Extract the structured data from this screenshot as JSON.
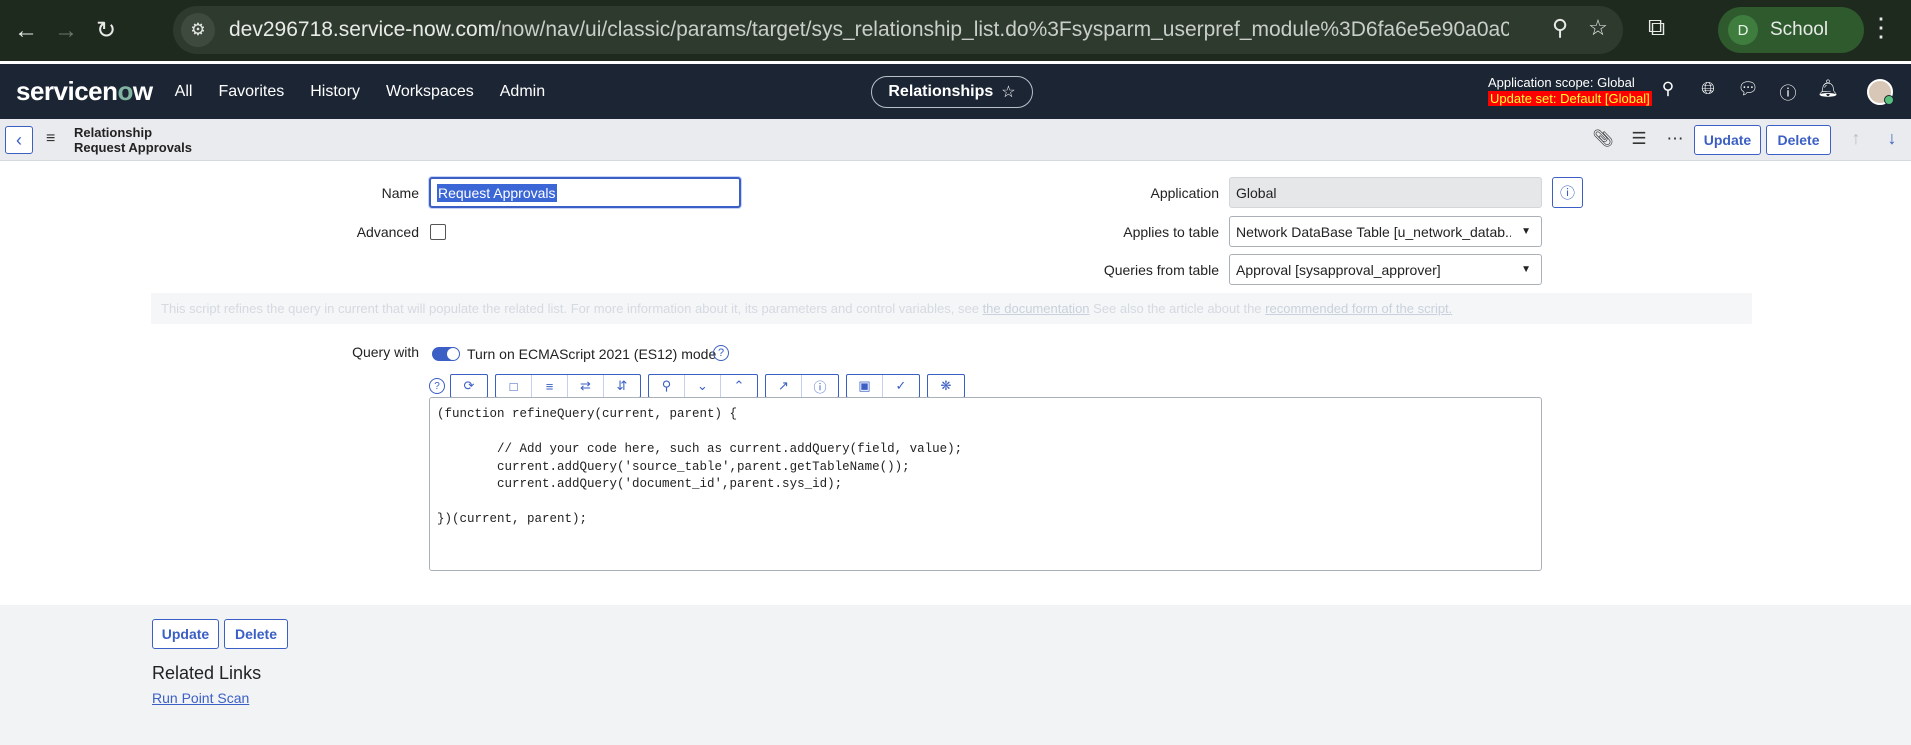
{
  "browser": {
    "url_main": "dev296718.service-now.com",
    "url_path": "/now/nav/ui/classic/params/target/sys_relationship_list.do%3Fsysparm_userpref_module%3D6fa6e5e90a0a0...",
    "profile_initial": "D",
    "profile_name": "School"
  },
  "header": {
    "logo": "servicenow",
    "nav": [
      "All",
      "Favorites",
      "History",
      "Workspaces",
      "Admin"
    ],
    "context_pill": "Relationships",
    "app_scope": "Application scope: Global",
    "update_set": "Update set: Default [Global]"
  },
  "form_header": {
    "table": "Relationship",
    "record": "Request Approvals",
    "update_label": "Update",
    "delete_label": "Delete"
  },
  "fields": {
    "name_label": "Name",
    "name_value": "Request Approvals",
    "advanced_label": "Advanced",
    "application_label": "Application",
    "application_value": "Global",
    "applies_label": "Applies to table",
    "applies_value": "Network DataBase Table [u_network_datab...",
    "queries_label": "Queries from table",
    "queries_value": "Approval [sysapproval_approver]"
  },
  "hint": {
    "text1": "This script refines the query in current that will populate the related list. For more information about it, its parameters and control variables, see ",
    "link1": "the documentation",
    "text2": " See also the article about the ",
    "link2": "recommended form of the script."
  },
  "script": {
    "query_label": "Query with",
    "toggle_label": "Turn on ECMAScript 2021 (ES12) mode",
    "code": "(function refineQuery(current, parent) {\n\n\t// Add your code here, such as current.addQuery(field, value);\n\tcurrent.addQuery('source_table',parent.getTableName());\n\tcurrent.addQuery('document_id',parent.sys_id);\n\n})(current, parent);"
  },
  "footer": {
    "update_label": "Update",
    "delete_label": "Delete",
    "related_links_title": "Related Links",
    "run_point_scan": "Run Point Scan"
  }
}
